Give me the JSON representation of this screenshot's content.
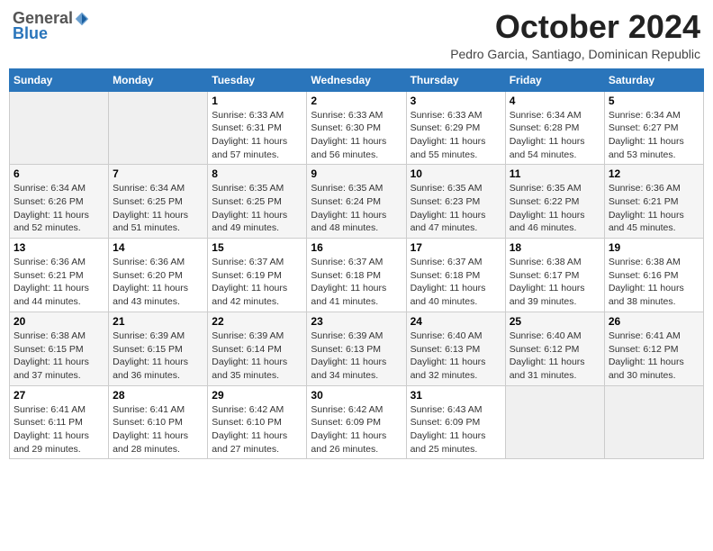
{
  "header": {
    "logo_general": "General",
    "logo_blue": "Blue",
    "month_title": "October 2024",
    "location": "Pedro Garcia, Santiago, Dominican Republic"
  },
  "weekdays": [
    "Sunday",
    "Monday",
    "Tuesday",
    "Wednesday",
    "Thursday",
    "Friday",
    "Saturday"
  ],
  "weeks": [
    [
      {
        "day": "",
        "info": ""
      },
      {
        "day": "",
        "info": ""
      },
      {
        "day": "1",
        "info": "Sunrise: 6:33 AM\nSunset: 6:31 PM\nDaylight: 11 hours and 57 minutes."
      },
      {
        "day": "2",
        "info": "Sunrise: 6:33 AM\nSunset: 6:30 PM\nDaylight: 11 hours and 56 minutes."
      },
      {
        "day": "3",
        "info": "Sunrise: 6:33 AM\nSunset: 6:29 PM\nDaylight: 11 hours and 55 minutes."
      },
      {
        "day": "4",
        "info": "Sunrise: 6:34 AM\nSunset: 6:28 PM\nDaylight: 11 hours and 54 minutes."
      },
      {
        "day": "5",
        "info": "Sunrise: 6:34 AM\nSunset: 6:27 PM\nDaylight: 11 hours and 53 minutes."
      }
    ],
    [
      {
        "day": "6",
        "info": "Sunrise: 6:34 AM\nSunset: 6:26 PM\nDaylight: 11 hours and 52 minutes."
      },
      {
        "day": "7",
        "info": "Sunrise: 6:34 AM\nSunset: 6:25 PM\nDaylight: 11 hours and 51 minutes."
      },
      {
        "day": "8",
        "info": "Sunrise: 6:35 AM\nSunset: 6:25 PM\nDaylight: 11 hours and 49 minutes."
      },
      {
        "day": "9",
        "info": "Sunrise: 6:35 AM\nSunset: 6:24 PM\nDaylight: 11 hours and 48 minutes."
      },
      {
        "day": "10",
        "info": "Sunrise: 6:35 AM\nSunset: 6:23 PM\nDaylight: 11 hours and 47 minutes."
      },
      {
        "day": "11",
        "info": "Sunrise: 6:35 AM\nSunset: 6:22 PM\nDaylight: 11 hours and 46 minutes."
      },
      {
        "day": "12",
        "info": "Sunrise: 6:36 AM\nSunset: 6:21 PM\nDaylight: 11 hours and 45 minutes."
      }
    ],
    [
      {
        "day": "13",
        "info": "Sunrise: 6:36 AM\nSunset: 6:21 PM\nDaylight: 11 hours and 44 minutes."
      },
      {
        "day": "14",
        "info": "Sunrise: 6:36 AM\nSunset: 6:20 PM\nDaylight: 11 hours and 43 minutes."
      },
      {
        "day": "15",
        "info": "Sunrise: 6:37 AM\nSunset: 6:19 PM\nDaylight: 11 hours and 42 minutes."
      },
      {
        "day": "16",
        "info": "Sunrise: 6:37 AM\nSunset: 6:18 PM\nDaylight: 11 hours and 41 minutes."
      },
      {
        "day": "17",
        "info": "Sunrise: 6:37 AM\nSunset: 6:18 PM\nDaylight: 11 hours and 40 minutes."
      },
      {
        "day": "18",
        "info": "Sunrise: 6:38 AM\nSunset: 6:17 PM\nDaylight: 11 hours and 39 minutes."
      },
      {
        "day": "19",
        "info": "Sunrise: 6:38 AM\nSunset: 6:16 PM\nDaylight: 11 hours and 38 minutes."
      }
    ],
    [
      {
        "day": "20",
        "info": "Sunrise: 6:38 AM\nSunset: 6:15 PM\nDaylight: 11 hours and 37 minutes."
      },
      {
        "day": "21",
        "info": "Sunrise: 6:39 AM\nSunset: 6:15 PM\nDaylight: 11 hours and 36 minutes."
      },
      {
        "day": "22",
        "info": "Sunrise: 6:39 AM\nSunset: 6:14 PM\nDaylight: 11 hours and 35 minutes."
      },
      {
        "day": "23",
        "info": "Sunrise: 6:39 AM\nSunset: 6:13 PM\nDaylight: 11 hours and 34 minutes."
      },
      {
        "day": "24",
        "info": "Sunrise: 6:40 AM\nSunset: 6:13 PM\nDaylight: 11 hours and 32 minutes."
      },
      {
        "day": "25",
        "info": "Sunrise: 6:40 AM\nSunset: 6:12 PM\nDaylight: 11 hours and 31 minutes."
      },
      {
        "day": "26",
        "info": "Sunrise: 6:41 AM\nSunset: 6:12 PM\nDaylight: 11 hours and 30 minutes."
      }
    ],
    [
      {
        "day": "27",
        "info": "Sunrise: 6:41 AM\nSunset: 6:11 PM\nDaylight: 11 hours and 29 minutes."
      },
      {
        "day": "28",
        "info": "Sunrise: 6:41 AM\nSunset: 6:10 PM\nDaylight: 11 hours and 28 minutes."
      },
      {
        "day": "29",
        "info": "Sunrise: 6:42 AM\nSunset: 6:10 PM\nDaylight: 11 hours and 27 minutes."
      },
      {
        "day": "30",
        "info": "Sunrise: 6:42 AM\nSunset: 6:09 PM\nDaylight: 11 hours and 26 minutes."
      },
      {
        "day": "31",
        "info": "Sunrise: 6:43 AM\nSunset: 6:09 PM\nDaylight: 11 hours and 25 minutes."
      },
      {
        "day": "",
        "info": ""
      },
      {
        "day": "",
        "info": ""
      }
    ]
  ]
}
